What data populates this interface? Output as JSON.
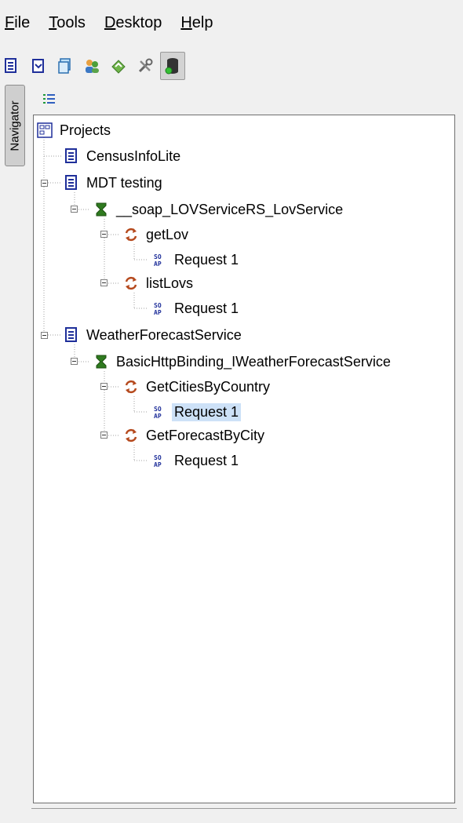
{
  "menu": {
    "file": "File",
    "tools": "Tools",
    "desktop": "Desktop",
    "help": "Help"
  },
  "toolbar_icons": [
    "new-project-icon",
    "open-project-icon",
    "save-icon",
    "users-icon",
    "sync-icon",
    "tools-icon",
    "database-icon"
  ],
  "side_tab": {
    "label": "Navigator"
  },
  "tree": {
    "root": "Projects",
    "project_1": "CensusInfoLite",
    "project_2": "MDT testing",
    "service_2": "__soap_LOVServiceRS_LovService",
    "op_2a": "getLov",
    "req_2a": "Request 1",
    "op_2b": "listLovs",
    "req_2b": "Request 1",
    "project_3": "WeatherForecastService",
    "service_3": "BasicHttpBinding_IWeatherForecastService",
    "op_3a": "GetCitiesByCountry",
    "req_3a": "Request 1",
    "op_3b": "GetForecastByCity",
    "req_3b": "Request 1"
  },
  "colors": {
    "selection": "#cde1f7",
    "project_icon": "#1f2f9a",
    "service_icon": "#2f7a1f",
    "operation_icon": "#b5491d"
  }
}
